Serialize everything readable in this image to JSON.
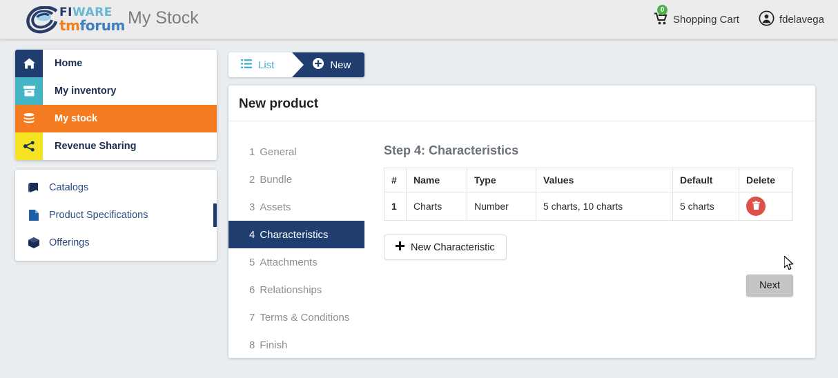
{
  "header": {
    "logo": {
      "fi": "FI",
      "ware": "WARE",
      "tm": "tm",
      "forum": "forum",
      "name": "fiware-tmforum-logo"
    },
    "app_title": "My Stock",
    "cart_label": "Shopping Cart",
    "cart_count": "0",
    "user_name": "fdelavega",
    "cart_icon": "shopping-cart-icon",
    "user_icon": "user-circle-icon",
    "badge_color": "#4cb14c",
    "bar_color": "#ececec"
  },
  "sidebar": {
    "nav": [
      {
        "label": "Home",
        "icon": "home-icon",
        "color": "#1f3d6e",
        "active": false
      },
      {
        "label": "My inventory",
        "icon": "archive-box-icon",
        "color": "#45b5c6",
        "active": false
      },
      {
        "label": "My stock",
        "icon": "database-icon",
        "color": "#f47b20",
        "active": true
      },
      {
        "label": "Revenue Sharing",
        "icon": "share-nodes-icon",
        "color": "#f5e223",
        "active": false
      }
    ],
    "sub": [
      {
        "label": "Catalogs",
        "icon": "book-icon",
        "active": false
      },
      {
        "label": "Product Specifications",
        "icon": "file-icon",
        "active": true
      },
      {
        "label": "Offerings",
        "icon": "cube-icon",
        "active": false
      }
    ]
  },
  "breadcrumb": {
    "list_label": "List",
    "list_icon": "list-icon",
    "new_label": "New",
    "new_icon": "plus-circle-icon",
    "active_color": "#1f3d6e"
  },
  "main": {
    "title": "New product",
    "steps": [
      {
        "num": "1",
        "label": "General",
        "active": false
      },
      {
        "num": "2",
        "label": "Bundle",
        "active": false
      },
      {
        "num": "3",
        "label": "Assets",
        "active": false
      },
      {
        "num": "4",
        "label": "Characteristics",
        "active": true
      },
      {
        "num": "5",
        "label": "Attachments",
        "active": false
      },
      {
        "num": "6",
        "label": "Relationships",
        "active": false
      },
      {
        "num": "7",
        "label": "Terms & Conditions",
        "active": false
      },
      {
        "num": "8",
        "label": "Finish",
        "active": false
      }
    ],
    "step_heading": "Step 4: Characteristics",
    "table": {
      "columns": [
        "#",
        "Name",
        "Type",
        "Values",
        "Default",
        "Delete"
      ],
      "rows": [
        {
          "idx": "1",
          "name": "Charts",
          "type": "Number",
          "values": "5 charts, 10 charts",
          "default": "5 charts",
          "delete_icon": "trash-icon"
        }
      ]
    },
    "new_char_label": "New Characteristic",
    "new_char_icon": "plus-icon",
    "next_label": "Next",
    "delete_color": "#dd5148"
  }
}
